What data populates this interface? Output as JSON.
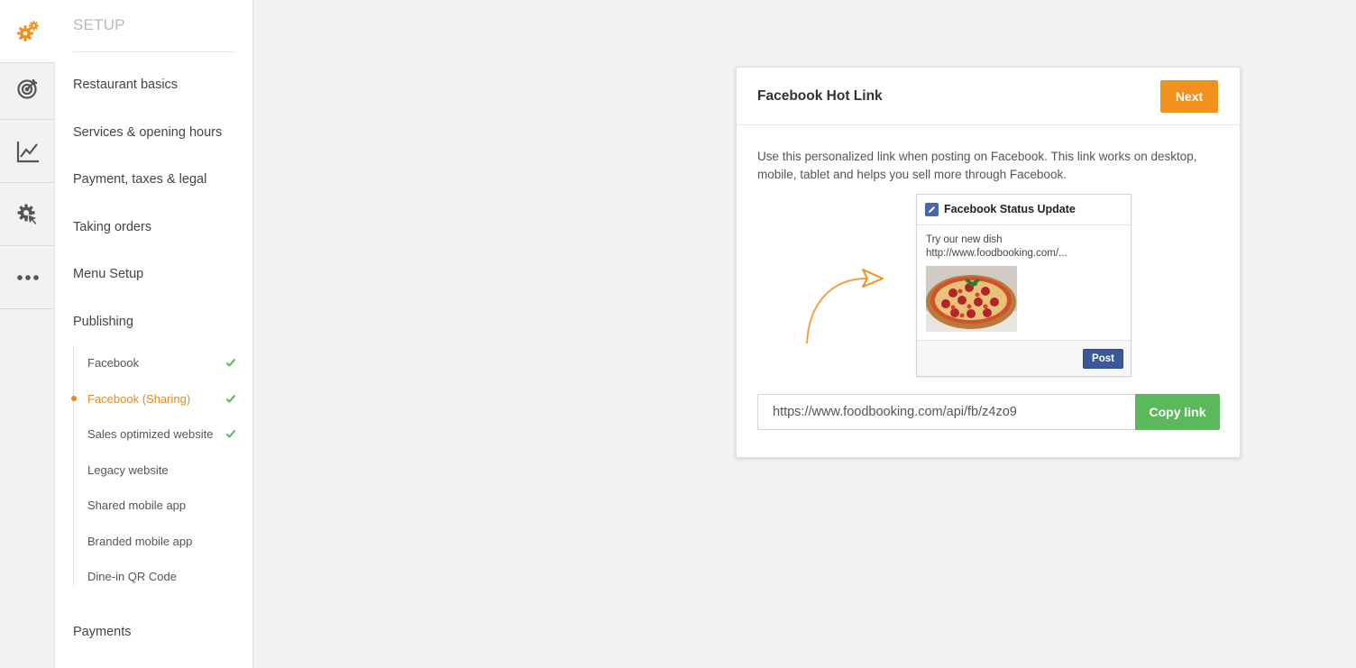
{
  "sidebar": {
    "title": "SETUP",
    "items": [
      {
        "label": "Restaurant basics"
      },
      {
        "label": "Services & opening hours"
      },
      {
        "label": "Payment, taxes & legal"
      },
      {
        "label": "Taking orders"
      },
      {
        "label": "Menu Setup"
      },
      {
        "label": "Publishing"
      }
    ],
    "publishing_sub": [
      {
        "label": "Facebook",
        "done": true
      },
      {
        "label": "Facebook (Sharing)",
        "done": true,
        "active": true
      },
      {
        "label": "Sales optimized website",
        "done": true
      },
      {
        "label": "Legacy website",
        "done": false
      },
      {
        "label": "Shared mobile app",
        "done": false
      },
      {
        "label": "Branded mobile app",
        "done": false
      },
      {
        "label": "Dine-in QR Code",
        "done": false
      }
    ],
    "bottom_item": "Payments"
  },
  "rail": {
    "icons": [
      "gears-icon",
      "target-icon",
      "chart-icon",
      "cursor-gear-icon",
      "more-icon"
    ]
  },
  "card": {
    "title": "Facebook Hot Link",
    "next_label": "Next",
    "description": "Use this personalized link when posting on Facebook. This link works on desktop, mobile, tablet and helps you sell more through Facebook.",
    "fb_preview": {
      "title": "Facebook Status Update",
      "line1": "Try our new dish",
      "line2": "http://www.foodbooking.com/...",
      "post_label": "Post"
    },
    "link_value": "https://www.foodbooking.com/api/fb/z4zo9",
    "copy_label": "Copy link"
  },
  "colors": {
    "accent": "#f0901e",
    "success": "#5cb85c",
    "facebook": "#3b5998"
  }
}
